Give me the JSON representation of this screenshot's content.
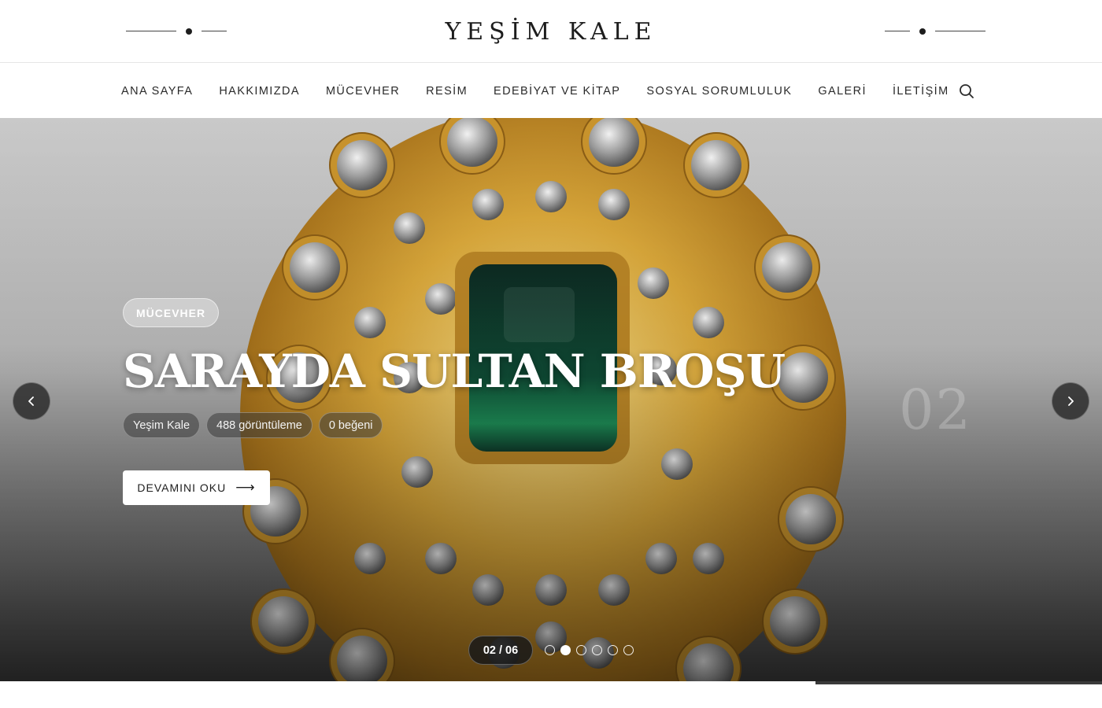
{
  "header": {
    "logo": "YEŞİM KALE"
  },
  "nav": {
    "items": [
      "ANA SAYFA",
      "HAKKIMIZDA",
      "MÜCEVHER",
      "RESİM",
      "EDEBİYAT VE KİTAP",
      "SOSYAL SORUMLULUK",
      "GALERİ",
      "İLETİŞİM"
    ],
    "search_icon": "search-icon"
  },
  "slider": {
    "category": "MÜCEVHER",
    "title": "SARAYDA SULTAN BROŞU",
    "author": "Yeşim Kale",
    "views": "488 görüntüleme",
    "likes": "0 beğeni",
    "read_more": "DEVAMINI OKU",
    "slide_number": "02",
    "counter": "02 / 06",
    "total_slides": 6,
    "active_slide": 2,
    "progress_fraction": 0.26,
    "prev_icon": "chevron-left-icon",
    "next_icon": "chevron-right-icon"
  }
}
